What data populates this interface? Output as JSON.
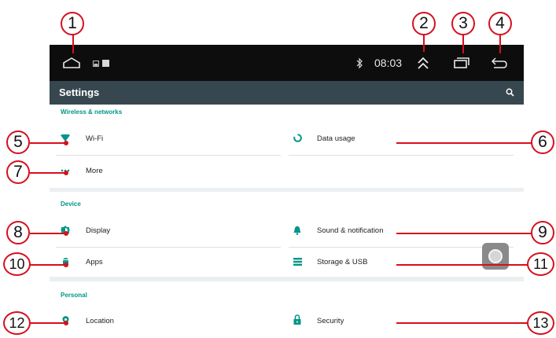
{
  "status_bar": {
    "time": "08:03",
    "icons": [
      "home-outline-icon",
      "screenshot-icon",
      "notification-square-icon",
      "bluetooth-icon",
      "expand-up-icon",
      "recent-apps-icon",
      "back-icon"
    ]
  },
  "toolbar": {
    "title": "Settings",
    "search_icon": "search-icon"
  },
  "sections": [
    {
      "header": "Wireless & networks",
      "items": [
        {
          "label": "Wi-Fi",
          "icon": "wifi-icon"
        },
        {
          "label": "Data usage",
          "icon": "data-usage-icon"
        },
        {
          "label": "More",
          "icon": "more-dots-icon"
        }
      ]
    },
    {
      "header": "Device",
      "items": [
        {
          "label": "Display",
          "icon": "display-brightness-icon"
        },
        {
          "label": "Sound & notification",
          "icon": "bell-icon"
        },
        {
          "label": "Apps",
          "icon": "android-icon"
        },
        {
          "label": "Storage & USB",
          "icon": "storage-icon"
        }
      ]
    },
    {
      "header": "Personal",
      "items": [
        {
          "label": "Location",
          "icon": "location-pin-icon"
        },
        {
          "label": "Security",
          "icon": "lock-icon"
        }
      ]
    }
  ],
  "callouts": [
    "1",
    "2",
    "3",
    "4",
    "5",
    "6",
    "7",
    "8",
    "9",
    "10",
    "11",
    "12",
    "13"
  ],
  "colors": {
    "accent_teal": "#009688",
    "callout_red": "#d5101e",
    "toolbar_bg": "#37474f",
    "status_bg": "#0d0d0d"
  }
}
